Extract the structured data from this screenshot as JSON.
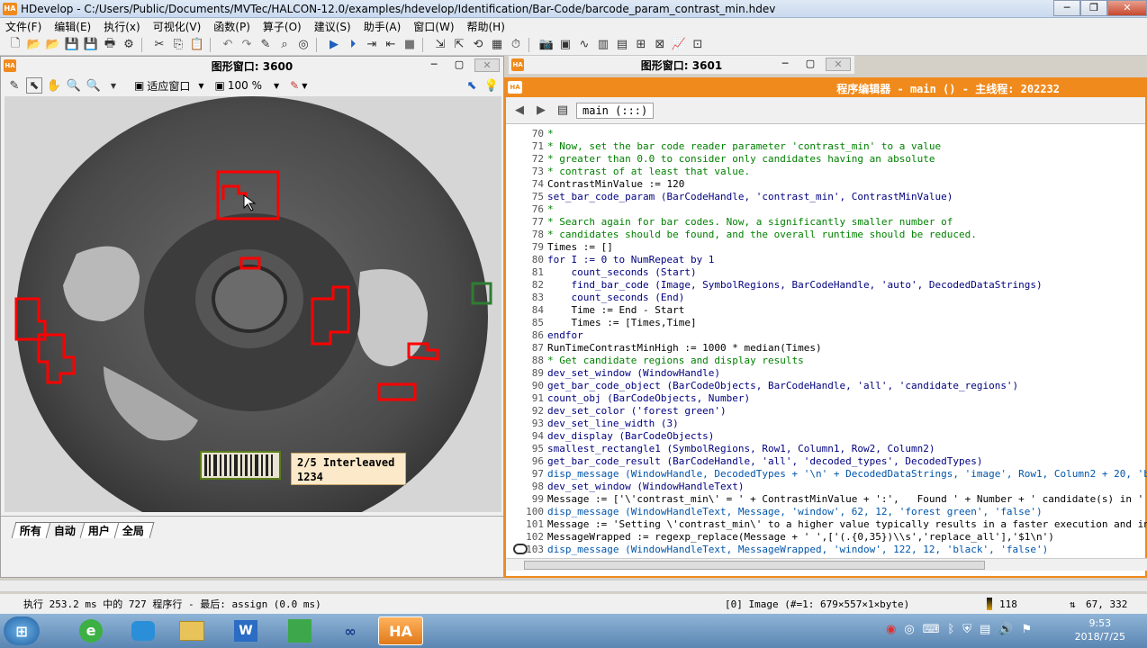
{
  "window": {
    "title": "HDevelop - C:/Users/Public/Documents/MVTec/HALCON-12.0/examples/hdevelop/Identification/Bar-Code/barcode_param_contrast_min.hdev",
    "app_icon": "HA",
    "minimize": "─",
    "restore": "❐",
    "close": "✕"
  },
  "menu": [
    "文件(F)",
    "编辑(E)",
    "执行(x)",
    "可视化(V)",
    "函数(P)",
    "算子(O)",
    "建议(S)",
    "助手(A)",
    "窗口(W)",
    "帮助(H)"
  ],
  "graphics_window_1": {
    "title": "图形窗口: 3600",
    "zoom_mode": "适应窗口",
    "zoom_percent": "100 %",
    "tabs": [
      "所有",
      "自动",
      "用户",
      "全局"
    ],
    "barcode_label_line1": "2/5 Interleaved",
    "barcode_label_line2": "1234"
  },
  "graphics_window_2": {
    "title": "图形窗口: 3601"
  },
  "program_editor": {
    "title": "程序编辑器 - main () - 主线程: 202232",
    "procedure": "main (:::)",
    "lines": [
      {
        "no": "70",
        "text": "*",
        "cls": "c-comment"
      },
      {
        "no": "71",
        "text": "* Now, set the bar code reader parameter 'contrast_min' to a value",
        "cls": "c-comment"
      },
      {
        "no": "72",
        "text": "* greater than 0.0 to consider only candidates having an absolute",
        "cls": "c-comment"
      },
      {
        "no": "73",
        "text": "* contrast of at least that value.",
        "cls": "c-comment"
      },
      {
        "no": "74",
        "text": "ContrastMinValue := 120",
        "cls": "c-op"
      },
      {
        "no": "75",
        "text": "set_bar_code_param (BarCodeHandle, 'contrast_min', ContrastMinValue)",
        "cls": "c-proc"
      },
      {
        "no": "76",
        "text": "*",
        "cls": "c-comment"
      },
      {
        "no": "77",
        "text": "* Search again for bar codes. Now, a significantly smaller number of",
        "cls": "c-comment"
      },
      {
        "no": "78",
        "text": "* candidates should be found, and the overall runtime should be reduced.",
        "cls": "c-comment"
      },
      {
        "no": "79",
        "text": "Times := []",
        "cls": "c-op"
      },
      {
        "no": "80",
        "text": "for I := 0 to NumRepeat by 1",
        "cls": "c-ctrl"
      },
      {
        "no": "81",
        "text": "    count_seconds (Start)",
        "cls": "c-proc"
      },
      {
        "no": "82",
        "text": "    find_bar_code (Image, SymbolRegions, BarCodeHandle, 'auto', DecodedDataStrings)",
        "cls": "c-proc"
      },
      {
        "no": "83",
        "text": "    count_seconds (End)",
        "cls": "c-proc"
      },
      {
        "no": "84",
        "text": "    Time := End - Start",
        "cls": "c-op"
      },
      {
        "no": "85",
        "text": "    Times := [Times,Time]",
        "cls": "c-op"
      },
      {
        "no": "86",
        "text": "endfor",
        "cls": "c-ctrl"
      },
      {
        "no": "87",
        "text": "RunTimeContrastMinHigh := 1000 * median(Times)",
        "cls": "c-op"
      },
      {
        "no": "88",
        "text": "* Get candidate regions and display results",
        "cls": "c-comment"
      },
      {
        "no": "89",
        "text": "dev_set_window (WindowHandle)",
        "cls": "c-proc"
      },
      {
        "no": "90",
        "text": "get_bar_code_object (BarCodeObjects, BarCodeHandle, 'all', 'candidate_regions')",
        "cls": "c-proc"
      },
      {
        "no": "91",
        "text": "count_obj (BarCodeObjects, Number)",
        "cls": "c-proc"
      },
      {
        "no": "92",
        "text": "dev_set_color ('forest green')",
        "cls": "c-proc"
      },
      {
        "no": "93",
        "text": "dev_set_line_width (3)",
        "cls": "c-proc"
      },
      {
        "no": "94",
        "text": "dev_display (BarCodeObjects)",
        "cls": "c-proc"
      },
      {
        "no": "95",
        "text": "smallest_rectangle1 (SymbolRegions, Row1, Column1, Row2, Column2)",
        "cls": "c-proc"
      },
      {
        "no": "96",
        "text": "get_bar_code_result (BarCodeHandle, 'all', 'decoded_types', DecodedTypes)",
        "cls": "c-proc"
      },
      {
        "no": "97",
        "text": "disp_message (WindowHandle, DecodedTypes + '\\n' + DecodedDataStrings, 'image', Row1, Column2 + 20, 'bl",
        "cls": "c-disp"
      },
      {
        "no": "98",
        "text": "dev_set_window (WindowHandleText)",
        "cls": "c-proc"
      },
      {
        "no": "99",
        "text": "Message := ['\\'contrast_min\\' = ' + ContrastMinValue + ':',   Found ' + Number + ' candidate(s) in '",
        "cls": "c-op"
      },
      {
        "no": "100",
        "text": "disp_message (WindowHandleText, Message, 'window', 62, 12, 'forest green', 'false')",
        "cls": "c-disp"
      },
      {
        "no": "101",
        "text": "Message := 'Setting \\'contrast_min\\' to a higher value typically results in a faster execution and in",
        "cls": "c-op"
      },
      {
        "no": "102",
        "text": "MessageWrapped := regexp_replace(Message + ' ',['(.{0,35})\\\\s','replace_all'],'$1\\n')",
        "cls": "c-op"
      },
      {
        "no": "103",
        "text": "disp_message (WindowHandleText, MessageWrapped, 'window', 122, 12, 'black', 'false')",
        "cls": "c-disp"
      }
    ]
  },
  "status": {
    "execution": "执行 253.2 ms 中的 727 程序行 - 最后: assign (0.0 ms)",
    "image_info": "[0] Image (#=1: 679×557×1×byte)",
    "gray_value": "118",
    "coords": "67, 332"
  },
  "taskbar": {
    "time": "9:53",
    "date": "2018/7/25"
  }
}
